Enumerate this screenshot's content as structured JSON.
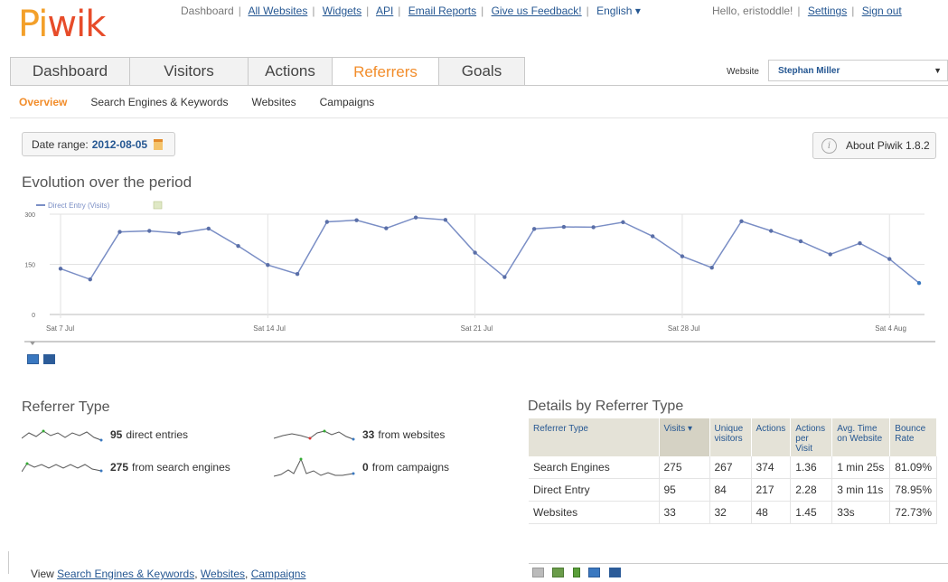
{
  "logo": {
    "part1": "Pi",
    "part2": "wik"
  },
  "top_links": [
    {
      "label": "Dashboard",
      "link": false
    },
    {
      "label": "All Websites",
      "link": true
    },
    {
      "label": "Widgets",
      "link": true
    },
    {
      "label": "API",
      "link": true
    },
    {
      "label": "Email Reports",
      "link": true
    },
    {
      "label": "Give us Feedback!",
      "link": true
    },
    {
      "label": "English ▾",
      "link": false
    }
  ],
  "user": {
    "greeting": "Hello, eristoddle!",
    "settings": "Settings",
    "signout": "Sign out"
  },
  "tabs": [
    "Dashboard",
    "Visitors",
    "Actions",
    "Referrers",
    "Goals"
  ],
  "active_tab": "Referrers",
  "website_selector": {
    "label": "Website",
    "value": "Stephan Miller"
  },
  "subtabs": [
    "Overview",
    "Search Engines & Keywords",
    "Websites",
    "Campaigns"
  ],
  "date_range": {
    "label": "Date range:",
    "value": "2012-08-05"
  },
  "about": "About Piwik 1.8.2",
  "evolution_title": "Evolution over the period",
  "chart_data": {
    "type": "line",
    "title": "",
    "series": [
      {
        "name": "Direct Entry (Visits)",
        "color": "#7a8ec5",
        "values": [
          137,
          105,
          247,
          250,
          243,
          257,
          205,
          148,
          121,
          277,
          282,
          258,
          290,
          283,
          185,
          112,
          256,
          262,
          261,
          276,
          234,
          174,
          140,
          279,
          250,
          219,
          180,
          213,
          166,
          94
        ]
      }
    ],
    "x_tick_labels": [
      "Sat 7 Jul",
      "Sat 14 Jul",
      "Sat 21 Jul",
      "Sat 28 Jul",
      "Sat 4 Aug"
    ],
    "y_tick_labels": [
      "0",
      "150",
      "300"
    ],
    "ylim": [
      0,
      300
    ],
    "grid": true
  },
  "referrer_type": {
    "title": "Referrer Type",
    "items": [
      {
        "value": "95",
        "text": "direct entries"
      },
      {
        "value": "33",
        "text": "from websites"
      },
      {
        "value": "275",
        "text": "from search engines"
      },
      {
        "value": "0",
        "text": "from campaigns"
      }
    ]
  },
  "details": {
    "title": "Details by Referrer Type",
    "headers": [
      "Referrer Type",
      "Visits ▾",
      "Unique visitors",
      "Actions",
      "Actions per Visit",
      "Avg. Time on Website",
      "Bounce Rate"
    ],
    "rows": [
      [
        "Search Engines",
        "275",
        "267",
        "374",
        "1.36",
        "1 min 25s",
        "81.09%"
      ],
      [
        "Direct Entry",
        "95",
        "84",
        "217",
        "2.28",
        "3 min 11s",
        "78.95%"
      ],
      [
        "Websites",
        "33",
        "32",
        "48",
        "1.45",
        "33s",
        "72.73%"
      ]
    ]
  },
  "view_links": {
    "prefix": "View",
    "links": [
      "Search Engines & Keywords",
      "Websites",
      "Campaigns"
    ]
  }
}
